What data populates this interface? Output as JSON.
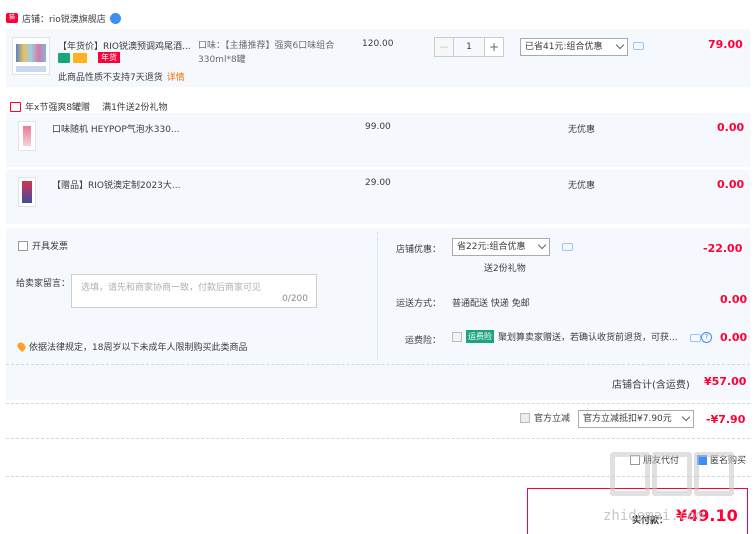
{
  "shop": {
    "tag": "天猫",
    "label": "店铺：rio锐澳旗舰店"
  },
  "main_item": {
    "title": "【年货价】RIO锐澳预调鸡尾酒...",
    "badge_year": "年货",
    "spec": "口味：【主播推荐】强爽6口味组合330ml*8罐",
    "unit_price": "120.00",
    "quantity": "1",
    "minus": "−",
    "plus": "+",
    "discount_select": "已省41元:组合优惠",
    "subtotal": "79.00",
    "no_return_note": "此商品性质不支持7天退货",
    "detail_link": "详情"
  },
  "gift_section": {
    "title": "年x节强爽8罐赠",
    "subtitle": "满1件送2份礼物",
    "items": [
      {
        "title": "口味随机 HEYPOP气泡水330...",
        "price": "99.00",
        "discount": "无优惠",
        "subtotal": "0.00"
      },
      {
        "title": "【赠品】RIO锐澳定制2023大...",
        "price": "29.00",
        "discount": "无优惠",
        "subtotal": "0.00"
      }
    ]
  },
  "invoice": {
    "label": "开具发票"
  },
  "message": {
    "label": "给卖家留言：",
    "placeholder": "选填，请先和商家协商一致，付款后商家可见",
    "counter": "0/200"
  },
  "legal_note": "依据法律规定，18周岁以下未成年人限制购买此类商品",
  "shop_discount": {
    "label": "店铺优惠：",
    "select": "省22元:组合优惠",
    "gift_note": "送2份礼物",
    "amount": "-22.00"
  },
  "shipping": {
    "label": "运送方式：",
    "value": "普通配送 快递 免邮",
    "amount": "0.00"
  },
  "insurance": {
    "label": "运费险：",
    "badge": "运费险",
    "text": "聚划算卖家赠送，若确认收货前退货，可获...",
    "amount": "0.00"
  },
  "shop_total": {
    "label": "店铺合计(含运费)",
    "amount": "¥57.00"
  },
  "official": {
    "label": "官方立减",
    "select": "官方立减抵扣¥7.90元",
    "amount": "-¥7.90"
  },
  "bottom": {
    "pay_for_other": "朋友代付",
    "anonymous": "匿名购买",
    "actual_label": "实付款：",
    "actual_amount": "¥49.10"
  },
  "watermark": "zhidemai.com",
  "colors": {
    "accent_red": "#ff0036",
    "row_bg": "#f5f8fc",
    "link_orange": "#ff6a00",
    "badge_green": "#1aa57a",
    "checkbox_blue": "#3e8ef7"
  }
}
